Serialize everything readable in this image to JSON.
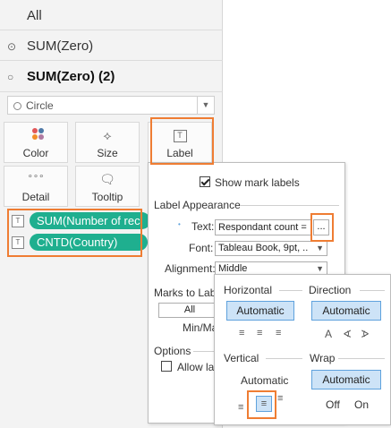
{
  "fields_list": {
    "all_label": "All",
    "sum_zero": "SUM(Zero)",
    "sum_zero_2": "SUM(Zero) (2)"
  },
  "mark_type": {
    "value": "Circle",
    "icon": "circle-icon"
  },
  "mark_buttons": [
    {
      "label": "Color",
      "icon": "color-dots-icon"
    },
    {
      "label": "Size",
      "icon": "size-icon"
    },
    {
      "label": "Label",
      "icon": "label-t-icon"
    },
    {
      "label": "Detail",
      "icon": "detail-dots-icon"
    },
    {
      "label": "Tooltip",
      "icon": "tooltip-bubble-icon"
    }
  ],
  "field_pills": [
    {
      "label": "SUM(Number of rec",
      "icon": "label-t-icon"
    },
    {
      "label": "CNTD(Country)",
      "icon": "label-t-icon"
    }
  ],
  "label_popup": {
    "show_mark_labels": "Show mark labels",
    "show_mark_labels_checked": true,
    "label_appearance": "Label Appearance",
    "text_label": "Text:",
    "text_value": "Respondant count =",
    "ellipsis_button": "...",
    "font_label": "Font:",
    "font_value": "Tableau Book, 9pt, ..",
    "alignment_label": "Alignment:",
    "alignment_value": "Middle",
    "marks_to_label": "Marks to Labe",
    "all_option": "All",
    "min_max": "Min/Ma",
    "options_header": "Options",
    "allow_labels": "Allow lab"
  },
  "alignment_popup": {
    "horizontal_header": "Horizontal",
    "direction_header": "Direction",
    "horizontal_auto": "Automatic",
    "direction_auto": "Automatic",
    "horizontal_icons": [
      "≡",
      "≡",
      "≡"
    ],
    "direction_icons": [
      "A",
      "∢",
      "∢"
    ],
    "vertical_header": "Vertical",
    "wrap_header": "Wrap",
    "vertical_auto": "Automatic",
    "wrap_auto": "Automatic",
    "vertical_icons": [
      "≡",
      "≡",
      "≡"
    ],
    "wrap_off": "Off",
    "wrap_on": "On"
  },
  "colors": {
    "accent_highlight": "#ef7d33",
    "pill_green": "#1faf8f",
    "selected_blue": "#cde3f7",
    "selected_border": "#5fa2dd"
  }
}
